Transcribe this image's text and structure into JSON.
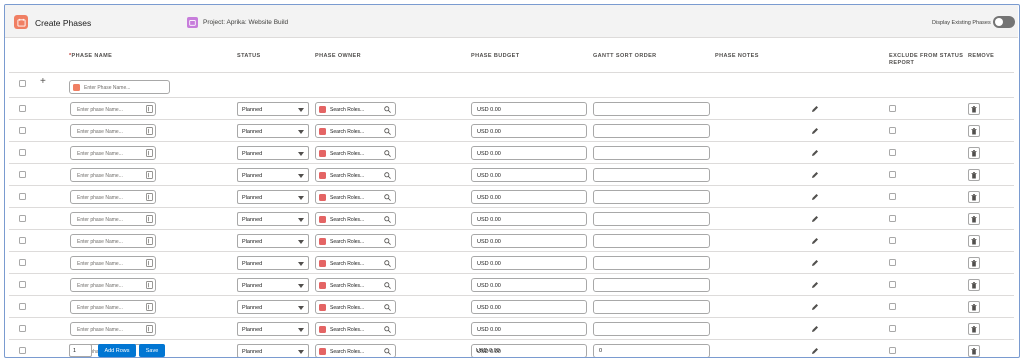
{
  "header": {
    "title": "Create Phases",
    "project_label": "Project: Aprika: Website Build",
    "toggle_label": "Display Existing Phases",
    "toggle_on": false
  },
  "columns": {
    "required_marker": "*",
    "phase_name": "PHASE NAME",
    "status": "STATUS",
    "phase_owner": "PHASE OWNER",
    "phase_budget": "PHASE BUDGET",
    "gantt_sort_order": "GANTT SORT ORDER",
    "phase_notes": "PHASE NOTES",
    "exclude_line1": "EXCLUDE FROM STATUS",
    "exclude_line2": "REPORT",
    "remove": "REMOVE"
  },
  "new_row": {
    "add_symbol": "+",
    "name_placeholder": "Enter Phase Name..."
  },
  "rows": [
    {
      "name_placeholder": "Enter phase Name...",
      "status": "Planned",
      "owner_placeholder": "Search Roles...",
      "budget": "USD 0.00",
      "gantt": ""
    },
    {
      "name_placeholder": "Enter phase Name...",
      "status": "Planned",
      "owner_placeholder": "Search Roles...",
      "budget": "USD 0.00",
      "gantt": ""
    },
    {
      "name_placeholder": "Enter phase Name...",
      "status": "Planned",
      "owner_placeholder": "Search Roles...",
      "budget": "USD 0.00",
      "gantt": ""
    },
    {
      "name_placeholder": "Enter phase Name...",
      "status": "Planned",
      "owner_placeholder": "Search Roles...",
      "budget": "USD 0.00",
      "gantt": ""
    },
    {
      "name_placeholder": "Enter phase Name...",
      "status": "Planned",
      "owner_placeholder": "Search Roles...",
      "budget": "USD 0.00",
      "gantt": ""
    },
    {
      "name_placeholder": "Enter phase Name...",
      "status": "Planned",
      "owner_placeholder": "Search Roles...",
      "budget": "USD 0.00",
      "gantt": ""
    },
    {
      "name_placeholder": "Enter phase Name...",
      "status": "Planned",
      "owner_placeholder": "Search Roles...",
      "budget": "USD 0.00",
      "gantt": ""
    },
    {
      "name_placeholder": "Enter phase Name...",
      "status": "Planned",
      "owner_placeholder": "Search Roles...",
      "budget": "USD 0.00",
      "gantt": ""
    },
    {
      "name_placeholder": "Enter phase Name...",
      "status": "Planned",
      "owner_placeholder": "Search Roles...",
      "budget": "USD 0.00",
      "gantt": ""
    },
    {
      "name_placeholder": "Enter phase Name...",
      "status": "Planned",
      "owner_placeholder": "Search Roles...",
      "budget": "USD 0.00",
      "gantt": ""
    },
    {
      "name_placeholder": "Enter phase Name...",
      "status": "Planned",
      "owner_placeholder": "Search Roles...",
      "budget": "USD 0.00",
      "gantt": ""
    },
    {
      "name_placeholder": "Enter phase Name...",
      "status": "Planned",
      "owner_placeholder": "Search Roles...",
      "budget": "USD 0.00",
      "gantt": ""
    }
  ],
  "row_icons": {
    "status_caret": "chevron-down-icon",
    "owner_icon": "role-icon",
    "owner_search": "search-icon",
    "notes": "pencil-icon",
    "remove": "trash-icon"
  },
  "footer": {
    "rows_to_add": "1",
    "add_rows_label": "Add Rows",
    "save_label": "Save",
    "budget_total": "USD 0.00",
    "gantt_total": "0"
  },
  "colors": {
    "brand_button": "#0176d3",
    "app_icon": "#f07f63",
    "project_icon": "#c77ddb",
    "role_icon": "#e46464"
  }
}
